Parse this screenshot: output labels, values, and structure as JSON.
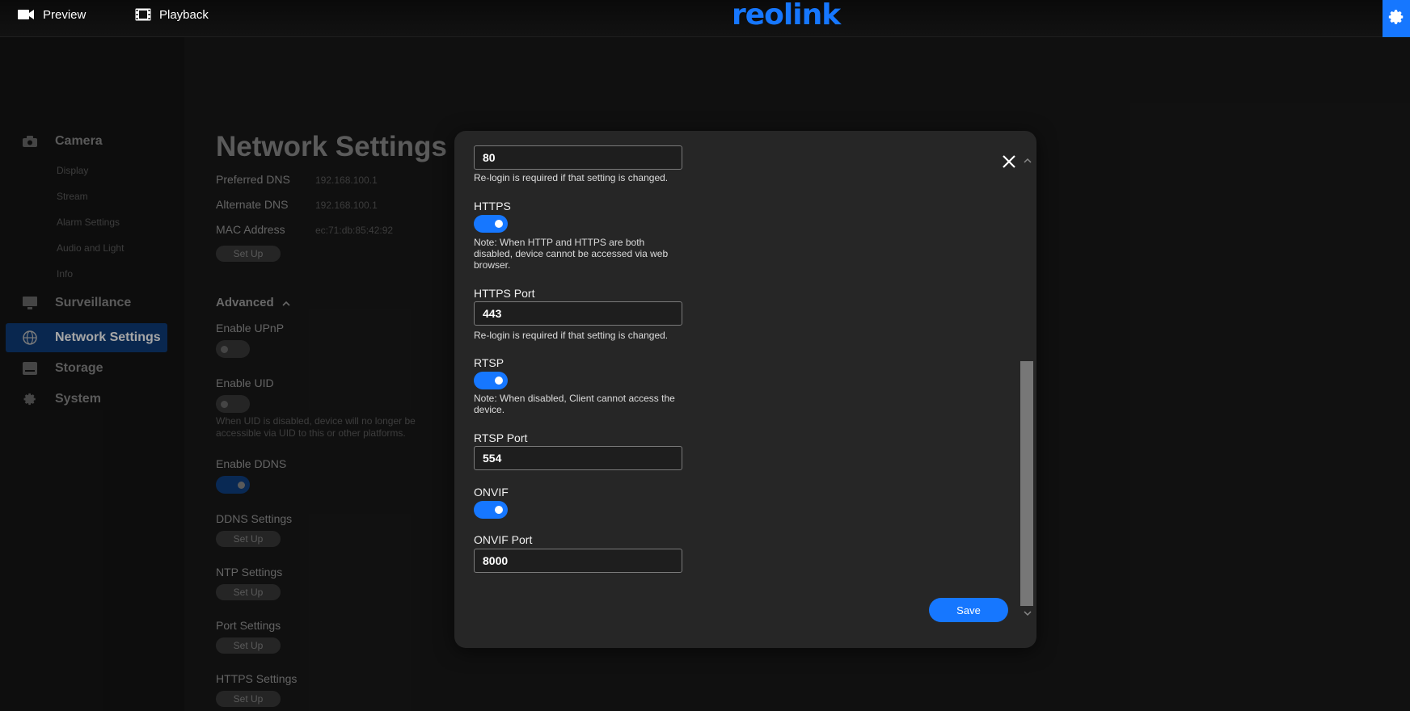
{
  "topbar": {
    "preview_label": "Preview",
    "playback_label": "Playback",
    "logo_text": "reolink",
    "accent_color": "#1677ff"
  },
  "sidebar": {
    "groups": [
      {
        "label": "Camera",
        "icon": "camera-icon"
      },
      {
        "label": "Surveillance",
        "icon": "monitor-icon"
      },
      {
        "label": "Network Settings",
        "icon": "globe-icon",
        "active": true
      },
      {
        "label": "Storage",
        "icon": "storage-icon"
      },
      {
        "label": "System",
        "icon": "gear-icon"
      }
    ],
    "camera_items": [
      "Display",
      "Stream",
      "Alarm Settings",
      "Audio and Light",
      "Info"
    ]
  },
  "main": {
    "title": "Network Settings",
    "preferred_dns_label": "Preferred DNS",
    "preferred_dns_value": "192.168.100.1",
    "alternate_dns_label": "Alternate DNS",
    "alternate_dns_value": "192.168.100.1",
    "mac_label": "MAC Address",
    "mac_value": "ec:71:db:85:42:92",
    "setup_label": "Set Up",
    "advanced_label": "Advanced",
    "upnp_label": "Enable UPnP",
    "uid_label": "Enable UID",
    "uid_note": "When UID is disabled, device will no longer be accessible via UID to this or other platforms.",
    "ddns_label": "Enable DDNS",
    "ddns_settings_label": "DDNS Settings",
    "ntp_settings_label": "NTP Settings",
    "port_settings_label": "Port Settings",
    "https_settings_label": "HTTPS Settings"
  },
  "modal": {
    "http_port_value": "80",
    "relogin_note": "Re-login is required if that setting is changed.",
    "https_label": "HTTPS",
    "https_enabled": true,
    "https_note": "Note: When HTTP and HTTPS are both disabled, device cannot be accessed via web browser.",
    "https_port_label": "HTTPS Port",
    "https_port_value": "443",
    "https_relogin_note": "Re-login is required if that setting is changed.",
    "rtsp_label": "RTSP",
    "rtsp_enabled": true,
    "rtsp_note": "Note: When disabled, Client cannot access the device.",
    "rtsp_port_label": "RTSP Port",
    "rtsp_port_value": "554",
    "onvif_label": "ONVIF",
    "onvif_enabled": true,
    "onvif_port_label": "ONVIF Port",
    "onvif_port_value": "8000",
    "save_label": "Save"
  }
}
